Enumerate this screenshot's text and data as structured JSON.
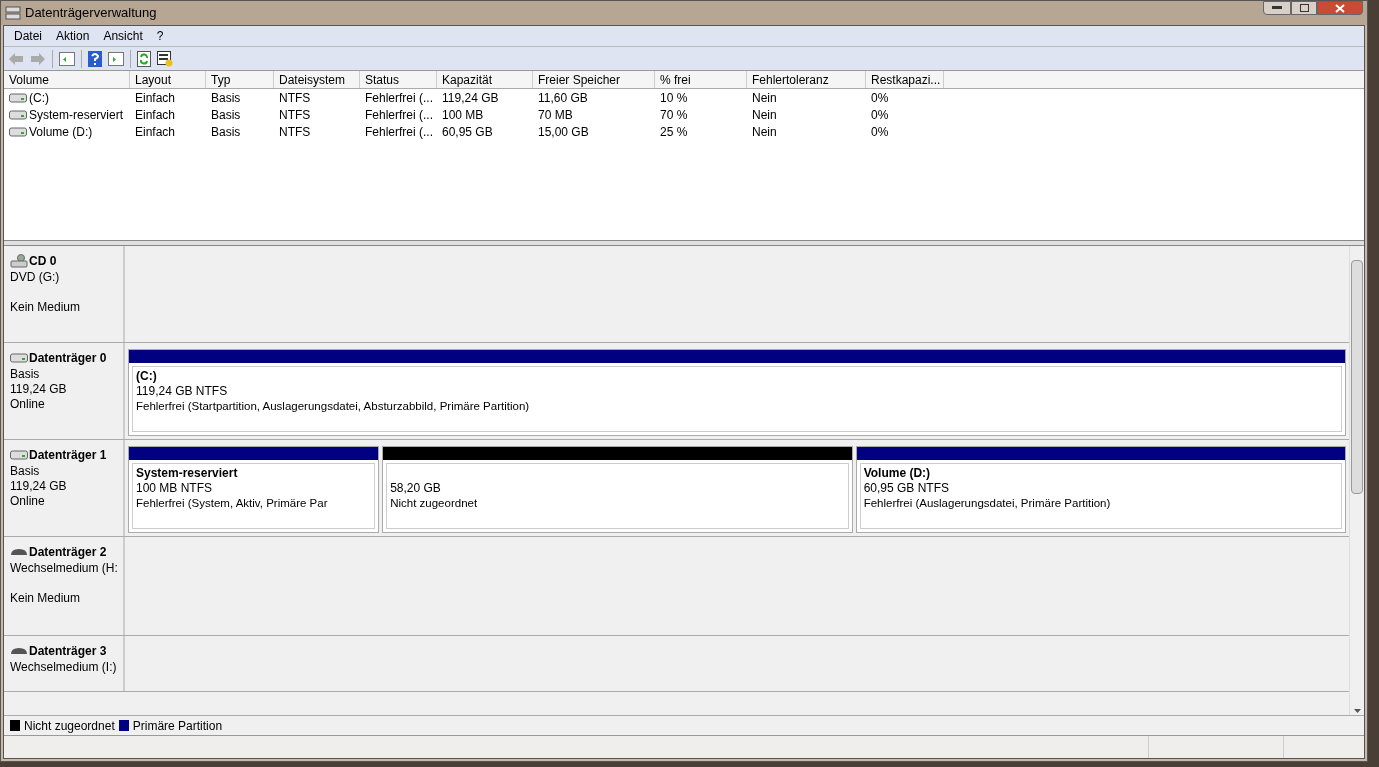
{
  "window": {
    "title": "Datenträgerverwaltung"
  },
  "menu": [
    "Datei",
    "Aktion",
    "Ansicht",
    "?"
  ],
  "table": {
    "columns": [
      "Volume",
      "Layout",
      "Typ",
      "Dateisystem",
      "Status",
      "Kapazität",
      "Freier Speicher",
      "% frei",
      "Fehlertoleranz",
      "Restkapazi..."
    ],
    "rows": [
      [
        "(C:)",
        "Einfach",
        "Basis",
        "NTFS",
        "Fehlerfrei (...",
        "119,24 GB",
        "11,60 GB",
        "10 %",
        "Nein",
        "0%"
      ],
      [
        "System-reserviert",
        "Einfach",
        "Basis",
        "NTFS",
        "Fehlerfrei (...",
        "100 MB",
        "70 MB",
        "70 %",
        "Nein",
        "0%"
      ],
      [
        "Volume (D:)",
        "Einfach",
        "Basis",
        "NTFS",
        "Fehlerfrei (...",
        "60,95 GB",
        "15,00 GB",
        "25 %",
        "Nein",
        "0%"
      ]
    ]
  },
  "disks": [
    {
      "kind": "cd",
      "name": "CD 0",
      "lines": [
        "DVD (G:)"
      ],
      "medium": "Kein Medium"
    },
    {
      "kind": "disk",
      "name": "Datenträger 0",
      "lines": [
        "Basis",
        "119,24 GB",
        "Online"
      ],
      "partitions": [
        {
          "kind": "primary",
          "name": "(C:)",
          "size": "119,24 GB NTFS",
          "status": "Fehlerfrei (Startpartition, Auslagerungsdatei, Absturzabbild, Primäre Partition)"
        }
      ]
    },
    {
      "kind": "disk",
      "name": "Datenträger 1",
      "lines": [
        "Basis",
        "119,24 GB",
        "Online"
      ],
      "partitions": [
        {
          "kind": "primary",
          "name": "System-reserviert",
          "size": "100 MB NTFS",
          "status": "Fehlerfrei (System, Aktiv, Primäre Par"
        },
        {
          "kind": "unallocated",
          "size": "58,20 GB",
          "status": "Nicht zugeordnet"
        },
        {
          "kind": "primary",
          "name": "Volume  (D:)",
          "size": "60,95 GB NTFS",
          "status": "Fehlerfrei (Auslagerungsdatei, Primäre Partition)"
        }
      ]
    },
    {
      "kind": "removable",
      "name": "Datenträger 2",
      "lines": [
        "Wechselmedium (H:"
      ],
      "medium": "Kein Medium"
    },
    {
      "kind": "removable",
      "name": "Datenträger 3",
      "lines": [
        "Wechselmedium (I:)"
      ]
    }
  ],
  "legend": [
    {
      "label": "Nicht zugeordnet",
      "color": "#000000"
    },
    {
      "label": "Primäre Partition",
      "color": "#000080"
    }
  ]
}
